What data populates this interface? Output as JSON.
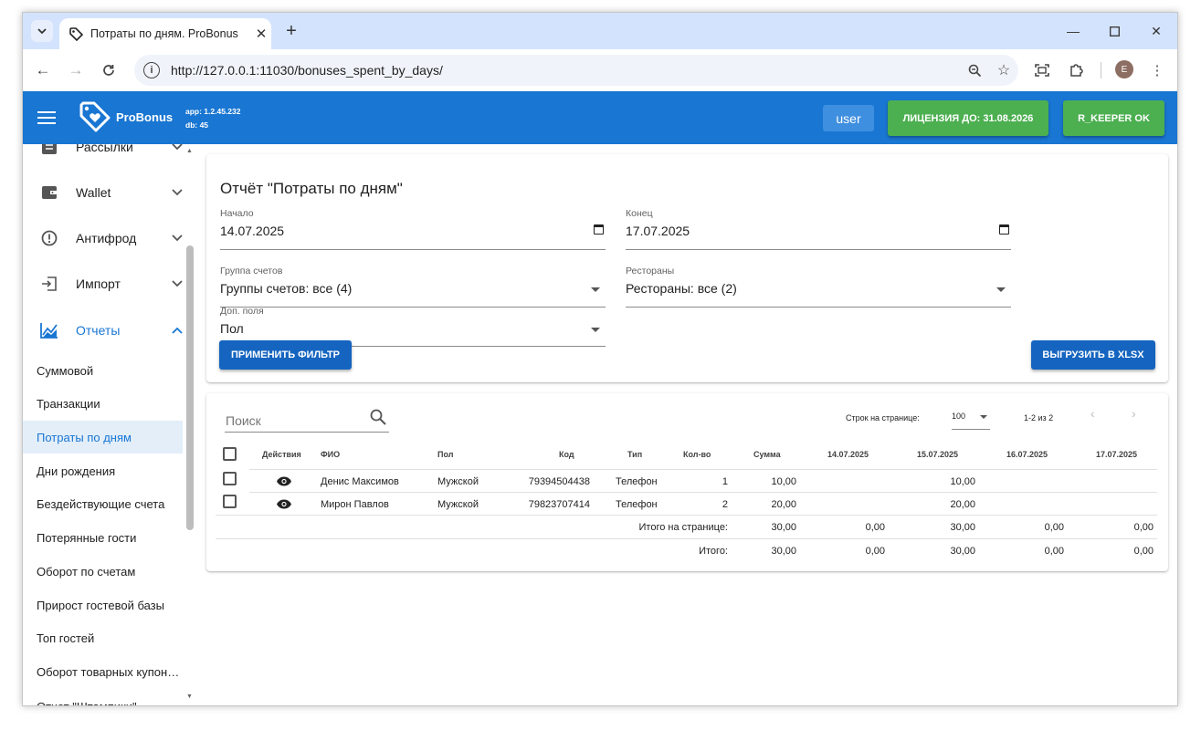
{
  "browser": {
    "tab_title": "Потраты по дням. ProBonus",
    "url": "http://127.0.0.1:11030/bonuses_spent_by_days/",
    "profile_initial": "E"
  },
  "appbar": {
    "logo_text": "ProBonus",
    "app_version": "app: 1.2.45.232",
    "db_version": "db: 45",
    "user": "user",
    "license": "ЛИЦЕНЗИЯ ДО: 31.08.2026",
    "rkeeper": "R_KEEPER OK"
  },
  "sidebar": {
    "groups": [
      {
        "label": "Рассылки",
        "icon": "mail-list-icon"
      },
      {
        "label": "Wallet",
        "icon": "wallet-icon"
      },
      {
        "label": "Антифрод",
        "icon": "alert-circle-icon"
      },
      {
        "label": "Импорт",
        "icon": "import-icon"
      },
      {
        "label": "Отчеты",
        "icon": "chart-icon"
      }
    ],
    "items": [
      "Суммовой",
      "Транзакции",
      "Потраты по дням",
      "Дни рождения",
      "Бездействующие счета",
      "Потерянные гости",
      "Оборот по счетам",
      "Прирост гостевой базы",
      "Топ гостей",
      "Оборот товарных купон…",
      "Отчет \"Штампики\""
    ],
    "active_item": "Потраты по дням"
  },
  "filter": {
    "title": "Отчёт \"Потраты по дням\"",
    "start_label": "Начало",
    "start_value": "14.07.2025",
    "end_label": "Конец",
    "end_value": "17.07.2025",
    "group_label": "Группа счетов",
    "group_value": "Группы счетов: все (4)",
    "restaurants_label": "Рестораны",
    "restaurants_value": "Рестораны: все (2)",
    "extra_label": "Доп. поля",
    "extra_value": "Пол",
    "apply_button": "ПРИМЕНИТЬ ФИЛЬТР",
    "export_button": "ВЫГРУЗИТЬ В XLSX"
  },
  "table": {
    "search_placeholder": "Поиск",
    "rows_per_page_label": "Строк на странице:",
    "rows_per_page": "100",
    "range": "1-2 из 2",
    "headers": {
      "actions": "Действия",
      "name": "ФИО",
      "gender": "Пол",
      "code": "Код",
      "type": "Тип",
      "qty": "Кол-во",
      "sum": "Сумма",
      "d1": "14.07.2025",
      "d2": "15.07.2025",
      "d3": "16.07.2025",
      "d4": "17.07.2025"
    },
    "rows": [
      {
        "name": "Денис Максимов",
        "gender": "Мужской",
        "code": "79394504438",
        "type": "Телефон",
        "qty": "1",
        "sum": "10,00",
        "d1": "",
        "d2": "10,00",
        "d3": "",
        "d4": ""
      },
      {
        "name": "Мирон Павлов",
        "gender": "Мужской",
        "code": "79823707414",
        "type": "Телефон",
        "qty": "2",
        "sum": "20,00",
        "d1": "",
        "d2": "20,00",
        "d3": "",
        "d4": ""
      }
    ],
    "page_total": {
      "label": "Итого на странице:",
      "sum": "30,00",
      "d1": "0,00",
      "d2": "30,00",
      "d3": "0,00",
      "d4": "0,00"
    },
    "grand_total": {
      "label": "Итого:",
      "sum": "30,00",
      "d1": "0,00",
      "d2": "30,00",
      "d3": "0,00",
      "d4": "0,00"
    }
  },
  "colors": {
    "appbar": "#1976d2",
    "license_green": "#4caf50",
    "primary_button": "#1565c0",
    "active_item_bg": "#e3eef9"
  }
}
